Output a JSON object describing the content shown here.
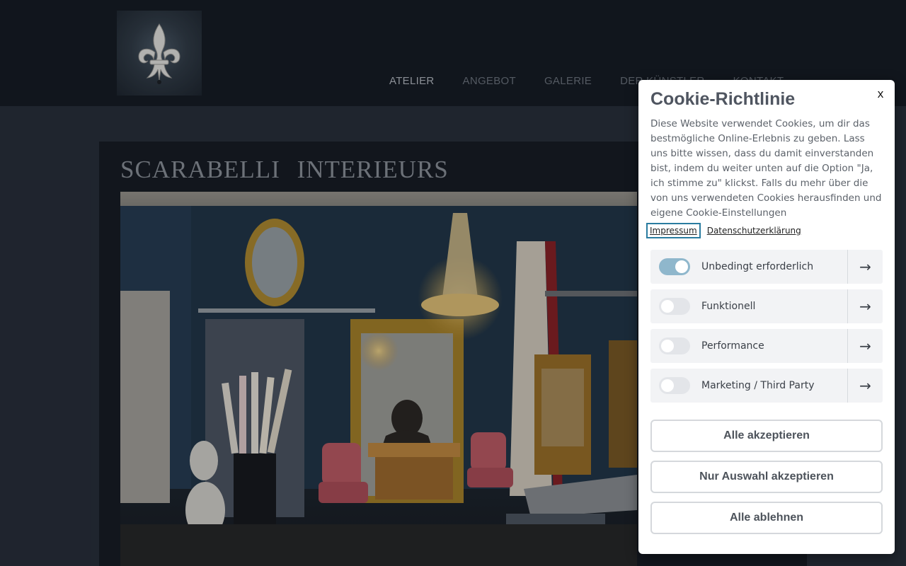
{
  "header": {
    "logo_alt": "fleur-de-lis logo",
    "nav": [
      {
        "label": "ATELIER",
        "active": true
      },
      {
        "label": "ANGEBOT",
        "active": false
      },
      {
        "label": "GALERIE",
        "active": false
      },
      {
        "label": "DER KÜNSTLER",
        "active": false
      },
      {
        "label": "KONTAKT",
        "active": false
      }
    ]
  },
  "content": {
    "brand_title": "SCARABELLI   INTERIEURS",
    "hero_description": "Atelier interior with gilded mirrors, chandelier, bust and antique chairs"
  },
  "cookie": {
    "close_label": "x",
    "title": "Cookie-Richtlinie",
    "text": "Diese Website verwendet Cookies, um dir das bestmögliche Online-Erlebnis zu geben. Lass uns bitte wissen, dass du damit einverstanden bist, indem du weiter unten auf die Option \"Ja, ich stimme zu\" klickst. Falls du mehr über die von uns verwendeten Cookies herausfinden und eigene Cookie-Einstellungen",
    "links": {
      "impressum": "Impressum",
      "datenschutz": "Datenschutzerklärung"
    },
    "categories": [
      {
        "label": "Unbedingt erforderlich",
        "enabled": true
      },
      {
        "label": "Funktionell",
        "enabled": false
      },
      {
        "label": "Performance",
        "enabled": false
      },
      {
        "label": "Marketing / Third Party",
        "enabled": false
      }
    ],
    "arrow_glyph": "→",
    "buttons": {
      "accept_all": "Alle akzeptieren",
      "accept_selection": "Nur Auswahl akzeptieren",
      "reject_all": "Alle ablehnen"
    }
  },
  "colors": {
    "header_bg": "#131820",
    "page_bg": "#262c37",
    "toggle_on": "#8fb7cc",
    "focus_outline": "#2a7ca0"
  }
}
